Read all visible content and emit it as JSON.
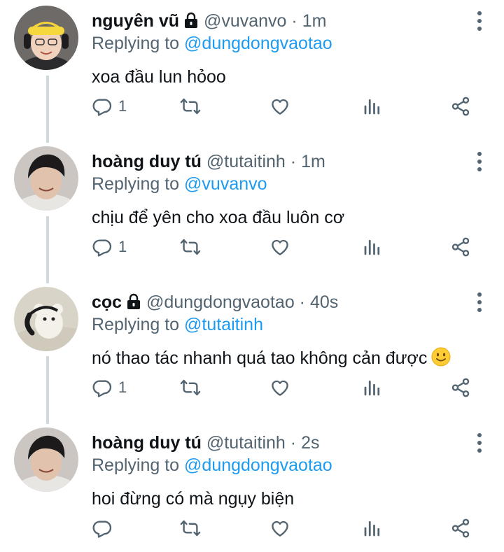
{
  "colors": {
    "link": "#1d9bf0",
    "muted": "#536471",
    "text": "#0f1419",
    "thread_line": "#cfd9de"
  },
  "tweets": [
    {
      "name": "nguyên vũ",
      "locked": true,
      "handle": "@vuvanvo",
      "dot": "·",
      "time": "1m",
      "replying_prefix": "Replying to",
      "replying_to": "@dungdongvaotao",
      "text": "xoa đầu lun hỏoo",
      "reply_count": "1",
      "avatar": "avatar-headset-yellow-beanie"
    },
    {
      "name": "hoàng duy tú",
      "locked": false,
      "handle": "@tutaitinh",
      "dot": "·",
      "time": "1m",
      "replying_prefix": "Replying to",
      "replying_to": "@vuvanvo",
      "text": "chịu để yên cho xoa đầu luôn cơ",
      "reply_count": "1",
      "avatar": "avatar-dark-hair"
    },
    {
      "name": "cọc",
      "locked": true,
      "handle": "@dungdongvaotao",
      "dot": "·",
      "time": "40s",
      "replying_prefix": "Replying to",
      "replying_to": "@tutaitinh",
      "text": "nó thao tác nhanh quá tao không cản được",
      "emoji": "slightly-smiling-face",
      "reply_count": "1",
      "avatar": "avatar-plush-bear-headphones"
    },
    {
      "name": "hoàng duy tú",
      "locked": false,
      "handle": "@tutaitinh",
      "dot": "·",
      "time": "2s",
      "replying_prefix": "Replying to",
      "replying_to": "@dungdongvaotao",
      "text": "hoi đừng có mà ngụy biện",
      "reply_count": "",
      "avatar": "avatar-dark-hair"
    }
  ]
}
